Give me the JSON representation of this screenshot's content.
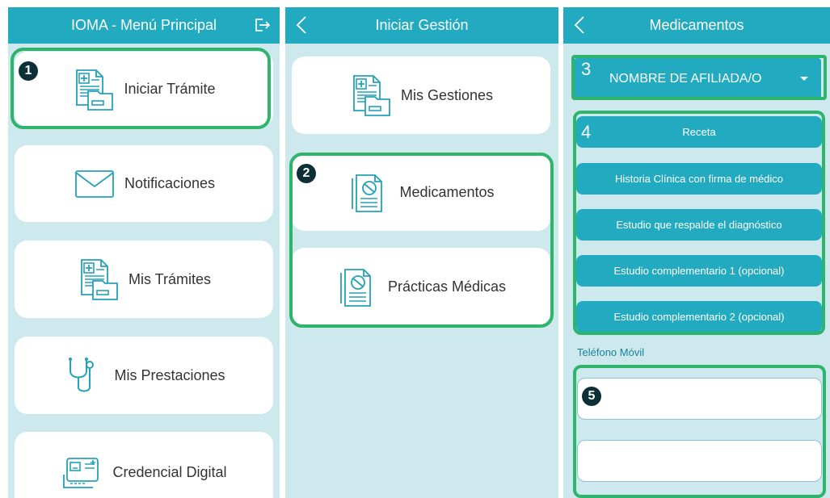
{
  "colors": {
    "header": "#22aac0",
    "background": "#cde9ee",
    "highlight": "#2fb46c",
    "badge": "#0d2f36"
  },
  "panel1": {
    "title": "IOMA - Menú Principal",
    "header_icon": "logout-icon",
    "items": [
      {
        "label": "Iniciar Trámite",
        "icon": "document-folder-icon"
      },
      {
        "label": "Notificaciones",
        "icon": "envelope-icon"
      },
      {
        "label": "Mis Trámites",
        "icon": "document-folder-icon"
      },
      {
        "label": "Mis Prestaciones",
        "icon": "stethoscope-icon"
      },
      {
        "label": "Credencial Digital",
        "icon": "id-card-icon"
      }
    ],
    "badge": "1"
  },
  "panel2": {
    "title": "Iniciar Gestión",
    "back_icon": "chevron-left-icon",
    "items": [
      {
        "label": "Mis Gestiones",
        "icon": "document-folder-icon"
      },
      {
        "label": "Medicamentos",
        "icon": "medicine-document-icon"
      },
      {
        "label": "Prácticas Médicas",
        "icon": "medicine-document-icon"
      }
    ],
    "badge": "2"
  },
  "panel3": {
    "title": "Medicamentos",
    "back_icon": "chevron-left-icon",
    "select_value": "NOMBRE DE AFILIADA/O",
    "buttons": [
      "Receta",
      "Historia Clínica con firma de médico",
      "Estudio que respalde el diagnóstico",
      "Estudio complementario 1 (opcional)",
      "Estudio complementario 2 (opcional)"
    ],
    "phone_label": "Teléfono Móvil",
    "phone_value": "",
    "phone_value_2": "",
    "num_select": "3",
    "num_buttons": "4",
    "badge_phone": "5"
  }
}
